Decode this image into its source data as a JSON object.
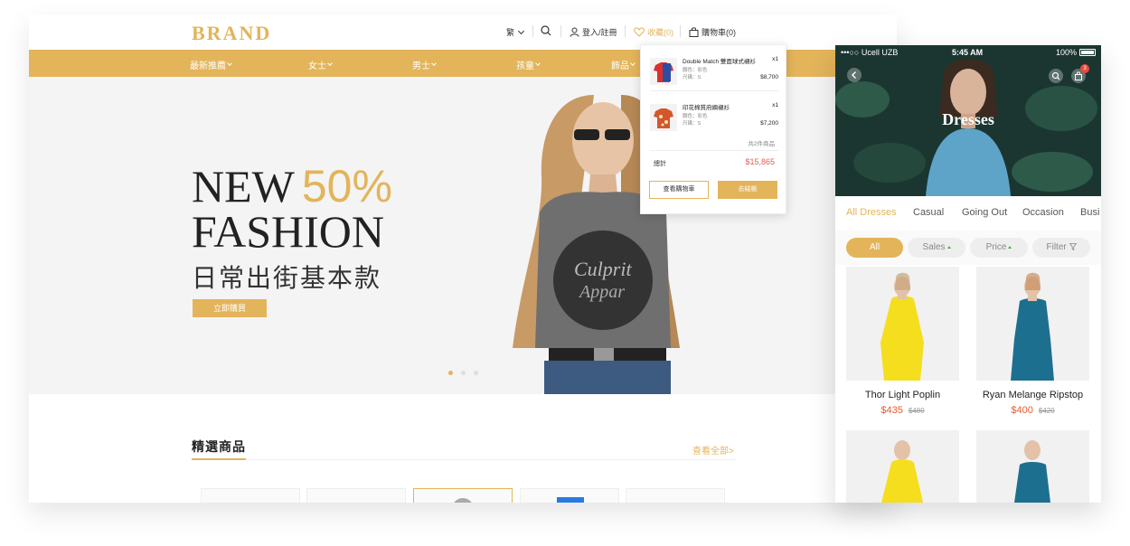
{
  "desktop": {
    "brand": "BRAND",
    "utility": {
      "lang": "繁",
      "login": "登入/註冊",
      "favorites": "收藏(0)",
      "cart": "購物車(0)"
    },
    "nav": [
      {
        "label": "最新推薦"
      },
      {
        "label": "女士"
      },
      {
        "label": "男士"
      },
      {
        "label": "孩童"
      },
      {
        "label": "飾品"
      }
    ],
    "hero": {
      "line1": "NEW",
      "percent": "50%",
      "line2": "FASHION",
      "subtitle": "日常出街基本款",
      "cta": "立即購買",
      "active_slide": 1,
      "slides": 3
    },
    "featured": {
      "title": "精選商品",
      "view_all": "查看全部>"
    },
    "cart_dropdown": {
      "items": [
        {
          "name": "Double Match 雙面球式襯衫",
          "qty": "x1",
          "color": "顏色：彩色",
          "size": "尺碼：S",
          "price": "$8,700"
        },
        {
          "name": "印花棉質府綢襯衫",
          "qty": "x1",
          "color": "顏色：彩色",
          "size": "尺碼：S",
          "price": "$7,200"
        }
      ],
      "count": "共2件商品",
      "total_label": "總計",
      "total": "$15,865",
      "view_cart": "查看購物車",
      "checkout": "去結帳"
    }
  },
  "mobile": {
    "status": {
      "carrier": "•••○○ Ucell UZB",
      "time": "5:45 AM",
      "battery": "100%"
    },
    "cart_badge": "3",
    "title": "Dresses",
    "tabs": [
      "All Dresses",
      "Casual",
      "Going Out",
      "Occasion",
      "Busi"
    ],
    "filters": {
      "all": "All",
      "sales": "Sales",
      "price": "Price",
      "filter": "Filter"
    },
    "products": [
      {
        "name": "Thor Light Poplin",
        "price": "$435",
        "old_price": "$480",
        "color": "#f5de1d"
      },
      {
        "name": "Ryan Melange Ripstop",
        "price": "$400",
        "old_price": "$420",
        "color": "#1d6f8f"
      }
    ]
  },
  "colors": {
    "accent": "#e3b45a",
    "sale": "#e85a2a"
  }
}
